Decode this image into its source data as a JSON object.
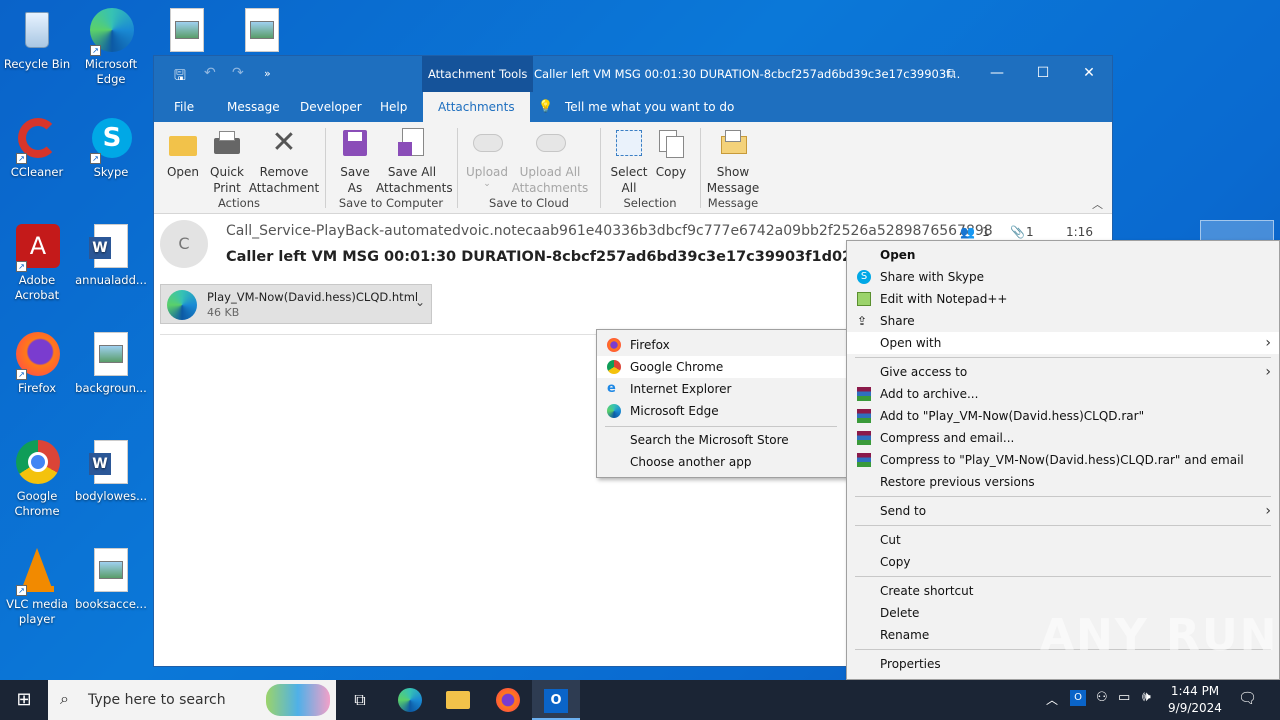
{
  "desktop": {
    "icons": [
      {
        "label": "Recycle Bin"
      },
      {
        "label": "Microsoft Edge"
      },
      {
        "label": "CCleaner"
      },
      {
        "label": "Skype"
      },
      {
        "label": "Adobe Acrobat"
      },
      {
        "label": "annualadd..."
      },
      {
        "label": "Firefox"
      },
      {
        "label": "backgroun..."
      },
      {
        "label": "Google Chrome"
      },
      {
        "label": "bodylowes..."
      },
      {
        "label": "VLC media player"
      },
      {
        "label": "booksacce..."
      }
    ]
  },
  "window": {
    "context_tab": "Attachment Tools",
    "title": "Caller left VM MSG 00:01:30 DURATION-8cbcf257ad6bd39c3e17c39903f...",
    "menu": [
      "File",
      "Message",
      "Developer",
      "Help",
      "Attachments"
    ],
    "tell_me": "Tell me what you want to do",
    "ribbon": {
      "open": "Open",
      "quick_print": "Quick Print",
      "remove_attachment": "Remove Attachment",
      "save_as": "Save As",
      "save_all": "Save All Attachments",
      "upload": "Upload",
      "upload_all": "Upload All Attachments",
      "select_all": "Select All",
      "copy": "Copy",
      "show_message": "Show Message",
      "groups": {
        "actions": "Actions",
        "save_to_computer": "Save to Computer",
        "save_to_cloud": "Save to Cloud",
        "selection": "Selection",
        "message": "Message"
      }
    },
    "message": {
      "avatar_letter": "C",
      "from": "Call_Service-PlayBack-automatedvoic.notecaab961e40336b3dbcf9c777e6742a09bb2f2526a5289876567898",
      "subject": "Caller left VM MSG 00:01:30 DURATION-8cbcf257ad6bd39c3e17c39903f1d02e",
      "people_count": "1",
      "attach_count": "1",
      "time": "1:16 PM",
      "attachment": {
        "name": "Play_VM-Now(David.hess)CLQD.html",
        "size": "46 KB"
      }
    }
  },
  "open_with_menu": {
    "items": [
      "Firefox",
      "Google Chrome",
      "Internet Explorer",
      "Microsoft Edge"
    ],
    "extra": [
      "Search the Microsoft Store",
      "Choose another app"
    ]
  },
  "context_menu": {
    "open": "Open",
    "share_skype": "Share with Skype",
    "edit_notepad": "Edit with Notepad++",
    "share": "Share",
    "open_with": "Open with",
    "give_access": "Give access to",
    "add_archive": "Add to archive...",
    "add_rar": "Add to \"Play_VM-Now(David.hess)CLQD.rar\"",
    "compress_email": "Compress and email...",
    "compress_rar_email": "Compress to \"Play_VM-Now(David.hess)CLQD.rar\" and email",
    "restore": "Restore previous versions",
    "send_to": "Send to",
    "cut": "Cut",
    "copy": "Copy",
    "create_shortcut": "Create shortcut",
    "delete": "Delete",
    "rename": "Rename",
    "properties": "Properties"
  },
  "taskbar": {
    "search_placeholder": "Type here to search",
    "time": "1:44 PM",
    "date": "9/9/2024"
  },
  "watermark": "ANY RUN"
}
